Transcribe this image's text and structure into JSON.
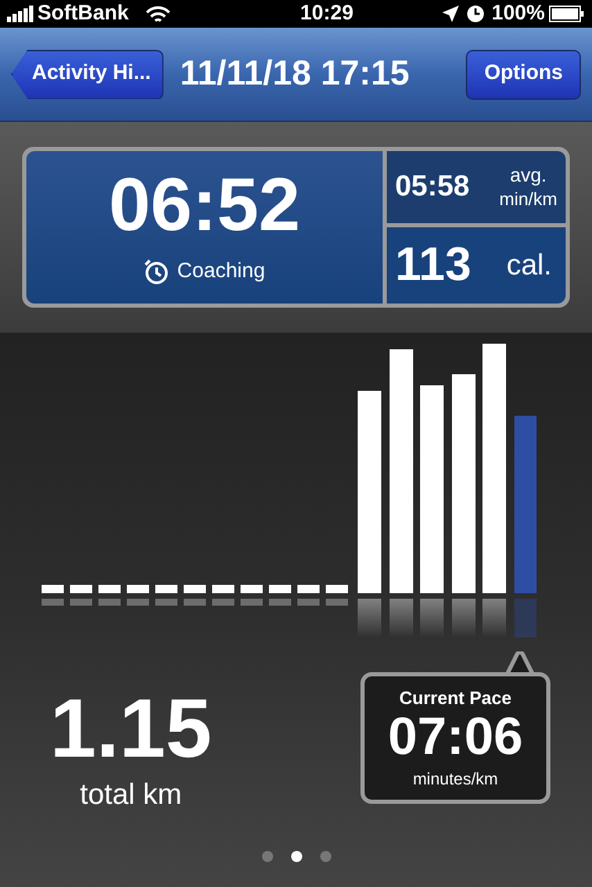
{
  "status_bar": {
    "carrier": "SoftBank",
    "time": "10:29",
    "battery": "100%"
  },
  "nav_bar": {
    "back_button": "Activity Hi...",
    "title": "11/11/18 17:15",
    "options_button": "Options"
  },
  "summary": {
    "duration": "06:52",
    "mode": "Coaching",
    "avg_pace": "05:58",
    "avg_label": "avg.",
    "avg_unit": "min/km",
    "calories": "113",
    "calories_unit": "cal."
  },
  "distance": {
    "value": "1.15",
    "unit": "total km"
  },
  "current_pace": {
    "title": "Current Pace",
    "value": "07:06",
    "unit": "minutes/km"
  },
  "page_dots": [
    {
      "selected": false
    },
    {
      "selected": true
    },
    {
      "selected": false
    }
  ]
}
